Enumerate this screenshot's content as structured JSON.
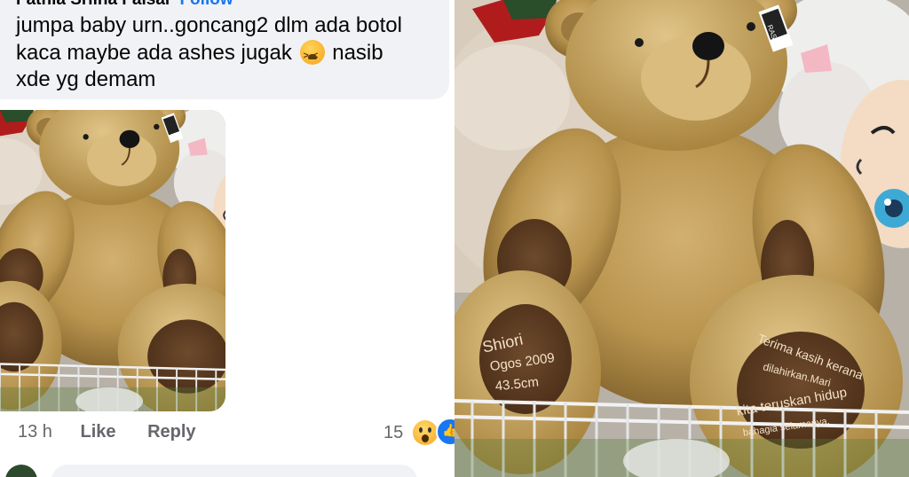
{
  "comment": {
    "author": "Fathia Sriina Faisal",
    "follow_label": "Follow",
    "text_line1": "jumpa baby urn..goncang2 dlm ada botol",
    "text_line2a": "kaca maybe ada ashes jugak",
    "text_line2b": "nasib",
    "text_line3": "xde yg demam",
    "emoji": "tired-face-emoji",
    "time": "13 h",
    "like_label": "Like",
    "reply_label": "Reply",
    "reaction_count": "15",
    "reactions": [
      "wow-emoji",
      "like-emoji"
    ]
  },
  "photo": {
    "left_paw": {
      "name": "Shiori",
      "date": "Ogos 2009",
      "size": "43.5cm"
    },
    "right_paw": {
      "line1": "Terima kasih kerana",
      "line2": "dilahirkan.Mari",
      "line3": "kita teruskan hidup",
      "line4": "bahagia selamanya."
    },
    "tag": "RAS00"
  },
  "colors": {
    "fb_blue": "#1877f2",
    "bubble_bg": "#f0f2f5",
    "meta_text": "#65676b",
    "bear_fur": "#b8944e",
    "paw_pad": "#5a3a22"
  }
}
